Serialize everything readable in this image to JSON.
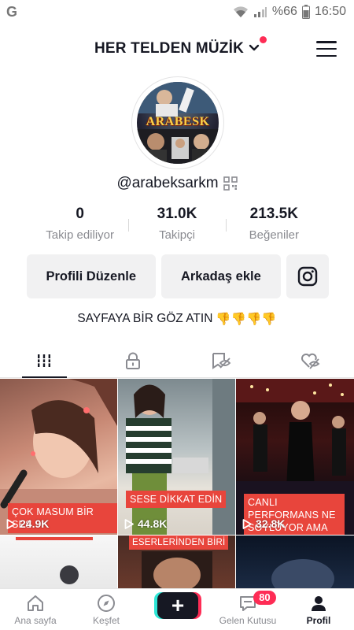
{
  "status_bar": {
    "left_icon": "google-g-icon",
    "left_glyph": "G",
    "battery": "%66",
    "time": "16:50"
  },
  "header": {
    "account_name": "HER TELDEN MÜZİK"
  },
  "profile": {
    "avatar_text": "ARABESK",
    "username": "@arabeksarkm",
    "stats": [
      {
        "value": "0",
        "label": "Takip ediliyor"
      },
      {
        "value": "31.0K",
        "label": "Takipçi"
      },
      {
        "value": "213.5K",
        "label": "Beğeniler"
      }
    ],
    "buttons": {
      "edit": "Profili Düzenle",
      "add_friend": "Arkadaş ekle"
    },
    "bio": "SAYFAYA BİR GÖZ ATIN",
    "bio_emoji": "👎👎👎👎"
  },
  "tabs": [
    {
      "name": "videos-grid-icon",
      "active": true
    },
    {
      "name": "lock-icon",
      "active": false
    },
    {
      "name": "tagged-hidden-icon",
      "active": false
    },
    {
      "name": "liked-hidden-icon",
      "active": false
    }
  ],
  "videos": [
    {
      "caption": "ÇOK MASUM BİR SES",
      "views": "24.9K"
    },
    {
      "caption": "SESE DİKKAT EDİN",
      "views": "44.8K"
    },
    {
      "caption": "CANLI PERFORMANS NE SÖYLÜYOR AMA",
      "views": "32.8K"
    },
    {
      "caption": "",
      "views": ""
    },
    {
      "caption": "ESERLERİNDEN BİRİ",
      "views": ""
    },
    {
      "caption": "",
      "views": ""
    }
  ],
  "bottom_nav": {
    "home": "Ana sayfa",
    "discover": "Keşfet",
    "create": "+",
    "inbox": "Gelen Kutusu",
    "inbox_badge": "80",
    "profile": "Profil"
  },
  "colors": {
    "accent_red": "#fe2c55",
    "caption_red": "#e8453c",
    "cyan": "#2ee6d6",
    "text_dark": "#161823",
    "text_muted": "#8a8b91"
  }
}
